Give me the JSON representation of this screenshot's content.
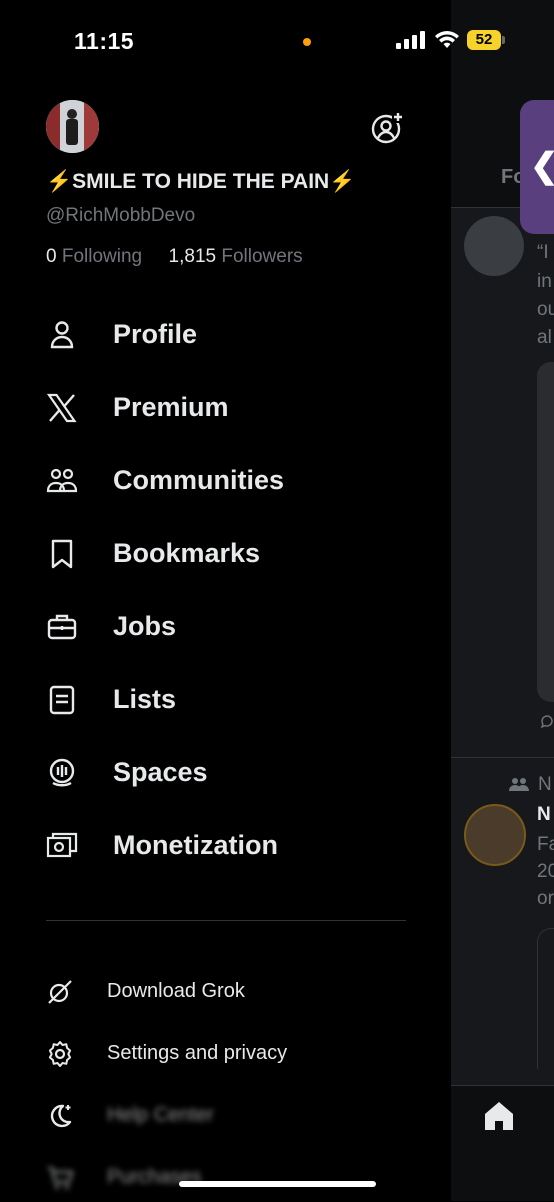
{
  "status": {
    "time": "11:15",
    "battery": "52"
  },
  "profile": {
    "name": "⚡️SMILE TO HIDE THE PAIN⚡️",
    "handle": "@RichMobbDevo",
    "following_count": "0",
    "following_label": "Following",
    "followers_count": "1,815",
    "followers_label": "Followers"
  },
  "menu": {
    "items": [
      {
        "label": "Profile",
        "icon": "person-icon"
      },
      {
        "label": "Premium",
        "icon": "x-logo-icon"
      },
      {
        "label": "Communities",
        "icon": "communities-icon"
      },
      {
        "label": "Bookmarks",
        "icon": "bookmark-icon"
      },
      {
        "label": "Jobs",
        "icon": "briefcase-icon"
      },
      {
        "label": "Lists",
        "icon": "list-icon"
      },
      {
        "label": "Spaces",
        "icon": "spaces-icon"
      },
      {
        "label": "Monetization",
        "icon": "money-icon"
      }
    ]
  },
  "secondary": {
    "items": [
      {
        "label": "Download Grok",
        "icon": "grok-icon"
      },
      {
        "label": "Settings and privacy",
        "icon": "gear-icon"
      },
      {
        "label": "Help Center",
        "icon": "moon-icon"
      },
      {
        "label": "Purchases",
        "icon": "cart-icon"
      }
    ]
  },
  "background": {
    "tab_label": "Fo",
    "snippet_lines": [
      "“I",
      "in",
      "ou",
      "al"
    ],
    "snippet2_lines": [
      "N",
      "Fa",
      "20",
      "or"
    ]
  },
  "colors": {
    "accent_battery": "#f6d32b",
    "pill": "#5a3f7e",
    "dim_text": "#71767b"
  }
}
